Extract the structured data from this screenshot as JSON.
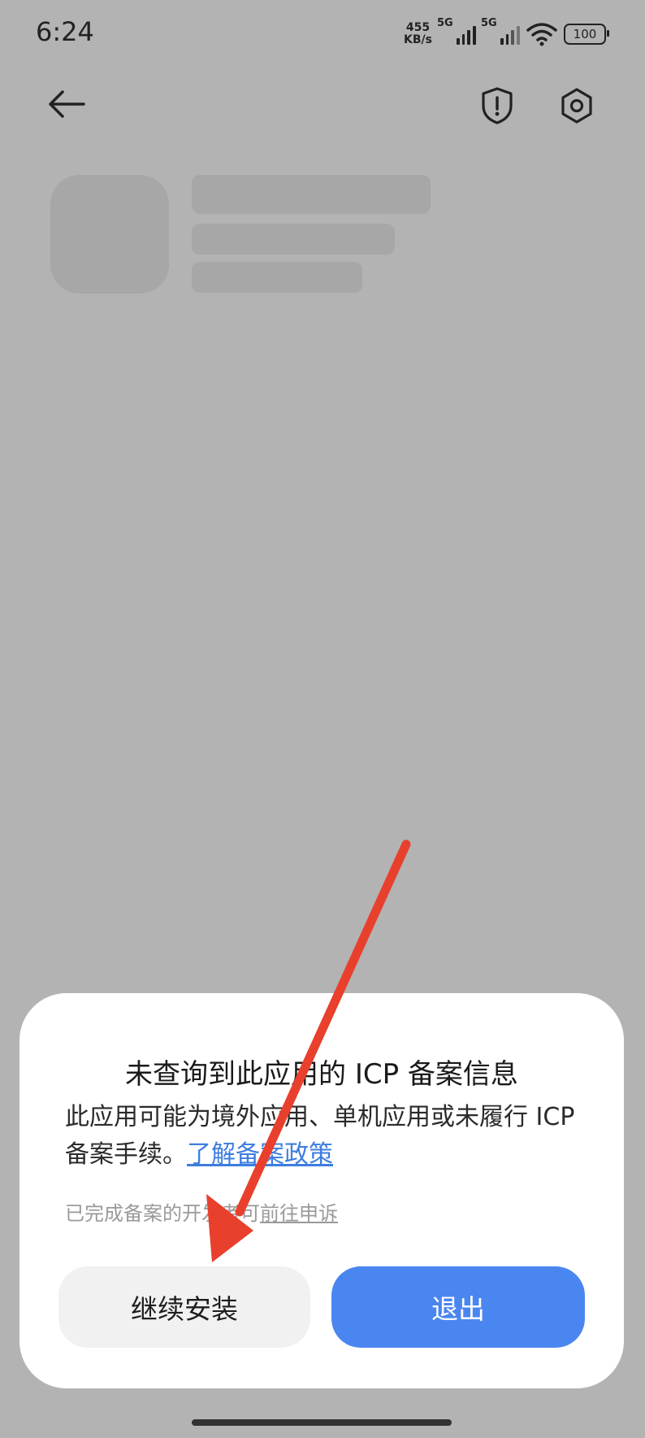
{
  "status_bar": {
    "time": "6:24",
    "net_speed_value": "455",
    "net_speed_unit": "KB/s",
    "signal1_label": "5G",
    "signal2_label": "5G",
    "battery": "100"
  },
  "dialog": {
    "title": "未查询到此应用的 ICP 备案信息",
    "body_text": "此应用可能为境外应用、单机应用或未履行 ICP 备案手续。",
    "policy_link": "了解备案政策",
    "note_text": "已完成备案的开发者可",
    "appeal_link": "前往申诉",
    "continue_button": "继续安装",
    "exit_button": "退出"
  },
  "icons": [
    "back-arrow-icon",
    "shield-alert-icon",
    "settings-icon",
    "wifi-icon",
    "signal-icon",
    "battery-icon"
  ],
  "colors": {
    "overlay": "#b3b3b3",
    "primary_button": "#4a86f0",
    "link": "#3d7de0",
    "annotation_arrow": "#e8402d"
  }
}
